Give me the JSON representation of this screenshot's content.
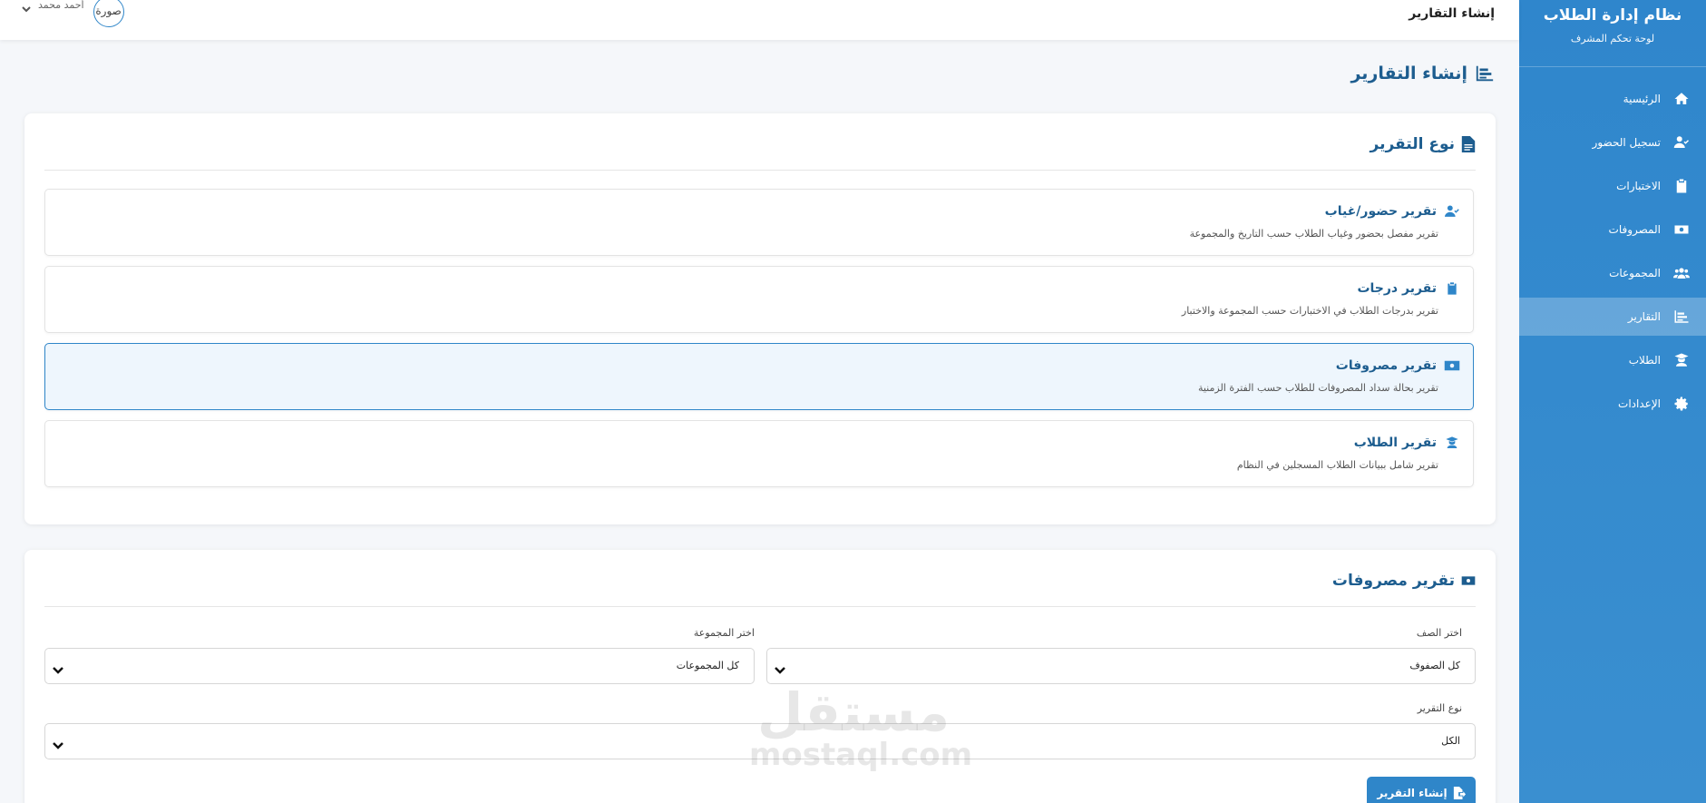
{
  "sidebar": {
    "title": "نظام إدارة الطلاب",
    "subtitle": "لوحة تحكم المشرف",
    "items": [
      {
        "label": "الرئيسية",
        "icon": "home-icon"
      },
      {
        "label": "تسجيل الحضور",
        "icon": "user-check-icon"
      },
      {
        "label": "الاختبارات",
        "icon": "clipboard-icon"
      },
      {
        "label": "المصروفات",
        "icon": "money-icon"
      },
      {
        "label": "المجموعات",
        "icon": "users-icon"
      },
      {
        "label": "التقارير",
        "icon": "chart-icon",
        "active": true
      },
      {
        "label": "الطلاب",
        "icon": "graduate-icon"
      },
      {
        "label": "الإعدادات",
        "icon": "gear-icon"
      }
    ],
    "bg_color": "#2f86c9"
  },
  "topbar": {
    "title": "إنشاء التقارير",
    "user_name": "أحمد محمد",
    "avatar_alt": "صورة"
  },
  "page": {
    "heading": "إنشاء التقارير"
  },
  "report_types": {
    "title": "نوع التقرير",
    "options": [
      {
        "title": "تقرير حضور/غياب",
        "desc": "تقرير مفصل بحضور وغياب الطلاب حسب التاريخ والمجموعة",
        "icon": "user-check-icon"
      },
      {
        "title": "تقرير درجات",
        "desc": "تقرير بدرجات الطلاب في الاختبارات حسب المجموعة والاختبار",
        "icon": "clipboard-icon"
      },
      {
        "title": "تقرير مصروفات",
        "desc": "تقرير بحالة سداد المصروفات للطلاب حسب الفترة الزمنية",
        "icon": "money-icon",
        "selected": true
      },
      {
        "title": "تقرير الطلاب",
        "desc": "تقرير شامل ببيانات الطلاب المسجلين في النظام",
        "icon": "graduate-icon"
      }
    ]
  },
  "form": {
    "title": "تقرير مصروفات",
    "class_label": "اختر الصف",
    "class_value": "كل الصفوف",
    "group_label": "اختر المجموعة",
    "group_value": "كل المجموعات",
    "type_label": "نوع التقرير",
    "type_value": "الكل",
    "submit_label": "إنشاء التقرير"
  },
  "watermark": {
    "ar": "مستقل",
    "en": "mostaql.com"
  },
  "colors": {
    "accent": "#2f86c9",
    "heading": "#1d5d8f"
  }
}
